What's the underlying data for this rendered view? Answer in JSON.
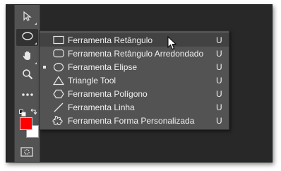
{
  "toolbar": {
    "tools": [
      {
        "name": "move-tool",
        "icon": "move-arrow-icon"
      },
      {
        "name": "ellipse-tool",
        "icon": "ellipse-icon",
        "active": true
      },
      {
        "name": "hand-tool",
        "icon": "hand-icon"
      },
      {
        "name": "zoom-tool",
        "icon": "magnifier-icon"
      },
      {
        "name": "more-tools",
        "icon": "ellipsis-icon"
      }
    ],
    "foreground_color": "#ff0000",
    "background_color": "#ffffff"
  },
  "flyout": {
    "items": [
      {
        "label": "Ferramenta Retângulo",
        "key": "U",
        "icon": "rectangle-icon",
        "hover": true,
        "current": false
      },
      {
        "label": "Ferramenta Retângulo Arredondado",
        "key": "U",
        "icon": "rounded-rectangle-icon",
        "hover": false,
        "current": false
      },
      {
        "label": "Ferramenta Elipse",
        "key": "U",
        "icon": "ellipse-icon",
        "hover": false,
        "current": true
      },
      {
        "label": "Triangle Tool",
        "key": "U",
        "icon": "triangle-icon",
        "hover": false,
        "current": false
      },
      {
        "label": "Ferramenta Polígono",
        "key": "U",
        "icon": "polygon-icon",
        "hover": false,
        "current": false
      },
      {
        "label": "Ferramenta Linha",
        "key": "U",
        "icon": "line-icon",
        "hover": false,
        "current": false
      },
      {
        "label": "Ferramenta Forma Personalizada",
        "key": "U",
        "icon": "custom-shape-icon",
        "hover": false,
        "current": false
      }
    ]
  },
  "colors": {
    "panel": "#535353",
    "hover": "#424242",
    "workspace": "#282828",
    "text": "#f0f0f0"
  }
}
